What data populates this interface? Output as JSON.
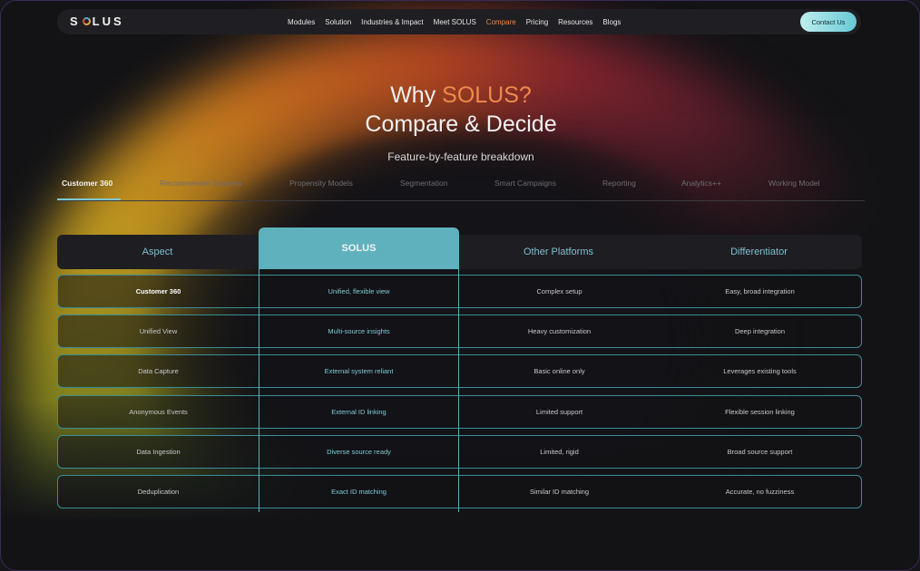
{
  "nav": {
    "logo": "SOLUS",
    "items": [
      "Modules",
      "Solution",
      "Industries & Impact",
      "Meet SOLUS",
      "Compare",
      "Pricing",
      "Resources",
      "Blogs"
    ],
    "active_item": "Compare",
    "contact_label": "Contact Us"
  },
  "hero": {
    "title_prefix": "Why ",
    "title_accent": "SOLUS?",
    "subtitle": "Compare & Decide",
    "tagline": "Feature-by-feature breakdown"
  },
  "tabs": [
    "Customer 360",
    "Recommender Systems",
    "Propensity Models",
    "Segmentation",
    "Smart Campaigns",
    "Reporting",
    "Analytics++",
    "Working Model"
  ],
  "active_tab": "Customer 360",
  "table": {
    "headers": [
      "Aspect",
      "SOLUS",
      "Other Platforms",
      "Differentiator"
    ],
    "rows": [
      [
        "Customer 360",
        "Unified, flexible view",
        "Complex setup",
        "Easy, broad integration"
      ],
      [
        "Unified View",
        "Multi-source insights",
        "Heavy customization",
        "Deep integration"
      ],
      [
        "Data Capture",
        "External system reliant",
        "Basic online only",
        "Leverages existing tools"
      ],
      [
        "Anonymous Events",
        "External ID linking",
        "Limited support",
        "Flexible session linking"
      ],
      [
        "Data Ingestion",
        "Diverse source ready",
        "Limited, rigid",
        "Broad source support"
      ],
      [
        "Deduplication",
        "Exact ID matching",
        "Similar ID matching",
        "Accurate, no fuzziness"
      ]
    ]
  },
  "colors": {
    "accent_orange": "#ee8a4c",
    "accent_teal": "#5fb1bd",
    "background": "#131316"
  }
}
